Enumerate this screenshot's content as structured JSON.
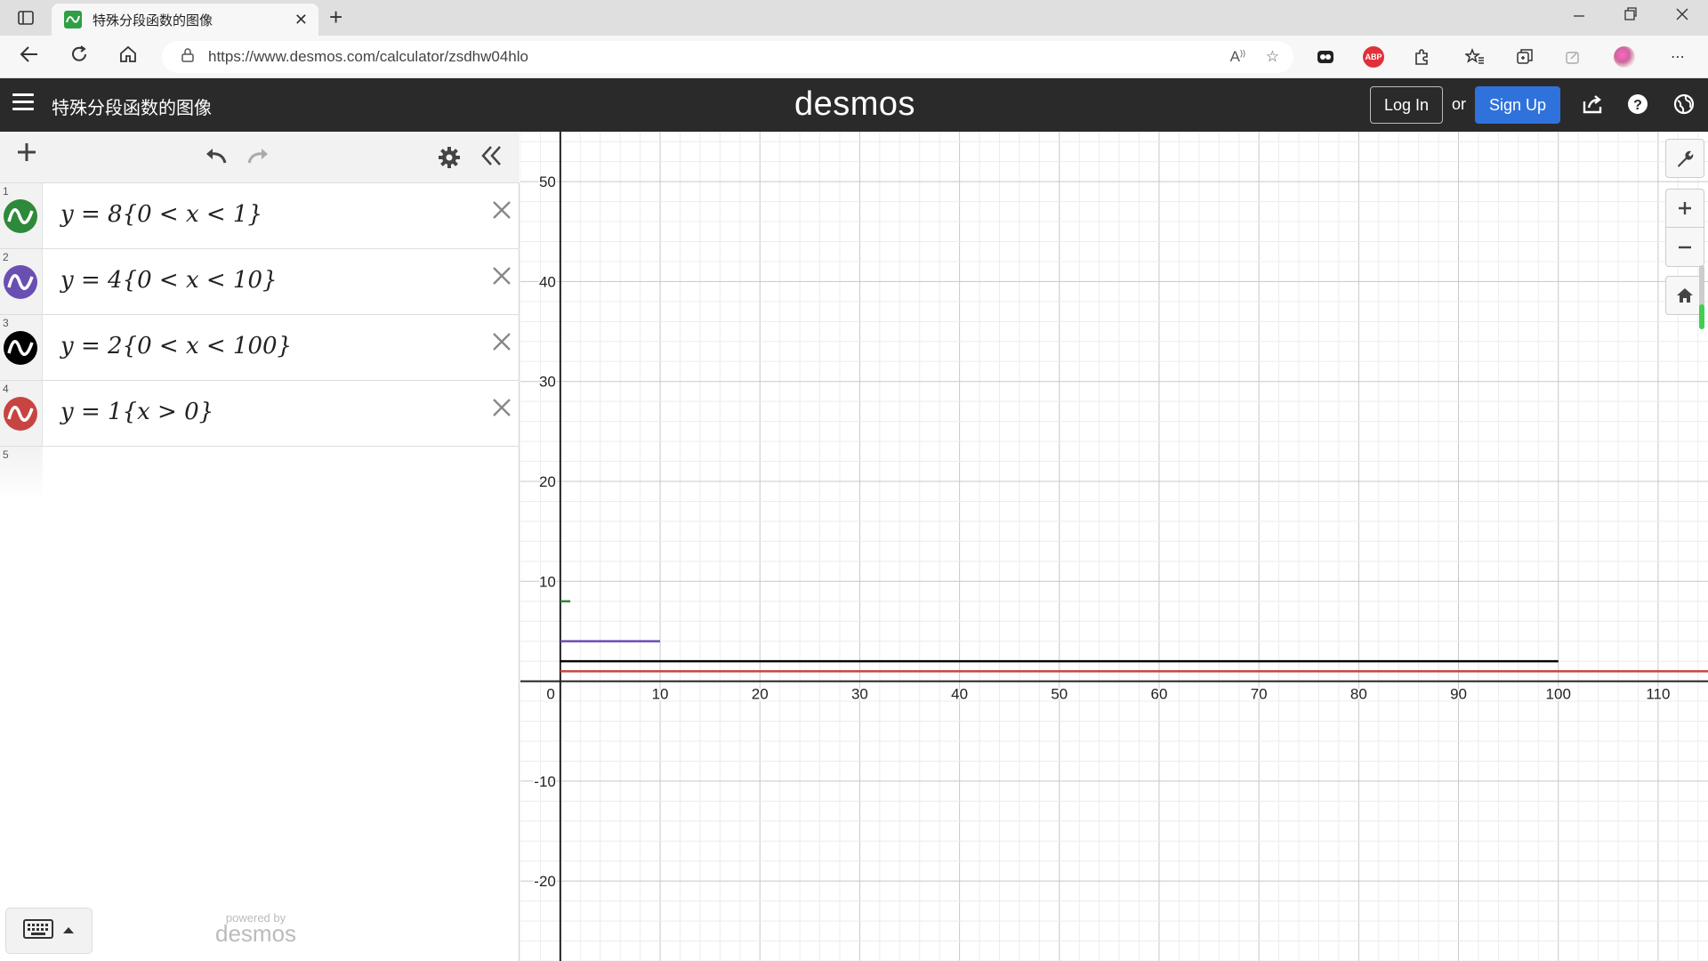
{
  "browser": {
    "tab_title": "特殊分段函数的图像",
    "url": "https://www.desmos.com/calculator/zsdhw04hlo",
    "new_tab_symbol": "+",
    "close_symbol": "✕"
  },
  "header": {
    "graph_title": "特殊分段函数的图像",
    "logo": "desmos",
    "login_label": "Log In",
    "or_text": "or",
    "signup_label": "Sign Up"
  },
  "expressions": [
    {
      "index": "1",
      "latex": "y = 8{0 < x < 1}",
      "color": "#2d8a3a"
    },
    {
      "index": "2",
      "latex": "y = 4{0 < x < 10}",
      "color": "#6a4fb3"
    },
    {
      "index": "3",
      "latex": "y = 2{0 < x < 100}",
      "color": "#000000"
    },
    {
      "index": "4",
      "latex": "y = 1{x > 0}",
      "color": "#c74440"
    }
  ],
  "empty_expression_index": "5",
  "footer": {
    "powered_by": "powered by",
    "powered_logo": "desmos"
  },
  "graph": {
    "x_ticks": [
      "10",
      "20",
      "30",
      "40",
      "50",
      "60",
      "70",
      "80",
      "90",
      "100",
      "110"
    ],
    "y_ticks": [
      "50",
      "40",
      "30",
      "20",
      "10",
      "-10",
      "-20"
    ],
    "origin_label": "0",
    "x_range": [
      -4,
      115
    ],
    "y_range": [
      -28,
      55
    ],
    "segments": [
      {
        "y": 8,
        "x_from": 0,
        "x_to": 1,
        "color": "#2d8a3a"
      },
      {
        "y": 4,
        "x_from": 0,
        "x_to": 10,
        "color": "#6a4fb3"
      },
      {
        "y": 2,
        "x_from": 0,
        "x_to": 100,
        "color": "#000000"
      },
      {
        "y": 1,
        "x_from": 0,
        "x_to": 120,
        "color": "#c74440"
      }
    ]
  },
  "icons": {
    "add": "plus-icon",
    "undo": "undo-icon",
    "redo": "redo-icon",
    "settings": "gear-icon",
    "collapse": "double-chevron-left-icon",
    "wrench": "wrench-icon",
    "zoom_in": "plus-icon",
    "zoom_out": "minus-icon",
    "home": "home-icon",
    "share": "share-icon",
    "help": "help-icon",
    "language": "globe-icon",
    "keyboard": "keyboard-icon"
  }
}
